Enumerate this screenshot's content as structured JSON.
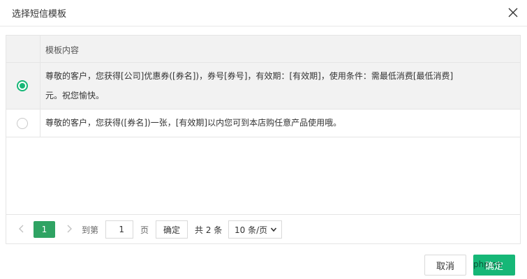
{
  "dialog": {
    "title": "选择短信模板",
    "close_icon": "close-icon"
  },
  "table": {
    "header": "模板内容",
    "rows": [
      {
        "selected": true,
        "content_line1": "尊敬的客户，您获得[公司]优惠券([券名])，券号[券号]，有效期：[有效期]，使用条件：需最低消费[最低消费]",
        "content_line2": "元。祝您愉快。"
      },
      {
        "selected": false,
        "content_line1": "尊敬的客户，您获得([券名])一张，[有效期]以内您可到本店购任意产品使用哦。"
      }
    ]
  },
  "pager": {
    "prev_icon": "chevron-left-icon",
    "next_icon": "chevron-right-icon",
    "current_page": "1",
    "goto_prefix": "到第",
    "goto_value": "1",
    "goto_suffix": "页",
    "goto_button": "确定",
    "total": "共 2 条",
    "page_size": "10 条/页"
  },
  "footer": {
    "cancel": "取消",
    "ok": "确定"
  },
  "watermark": "php.cn",
  "colors": {
    "accent": "#16b777",
    "page_active": "#2fa363",
    "row_selected_bg": "#f2f2f2"
  }
}
